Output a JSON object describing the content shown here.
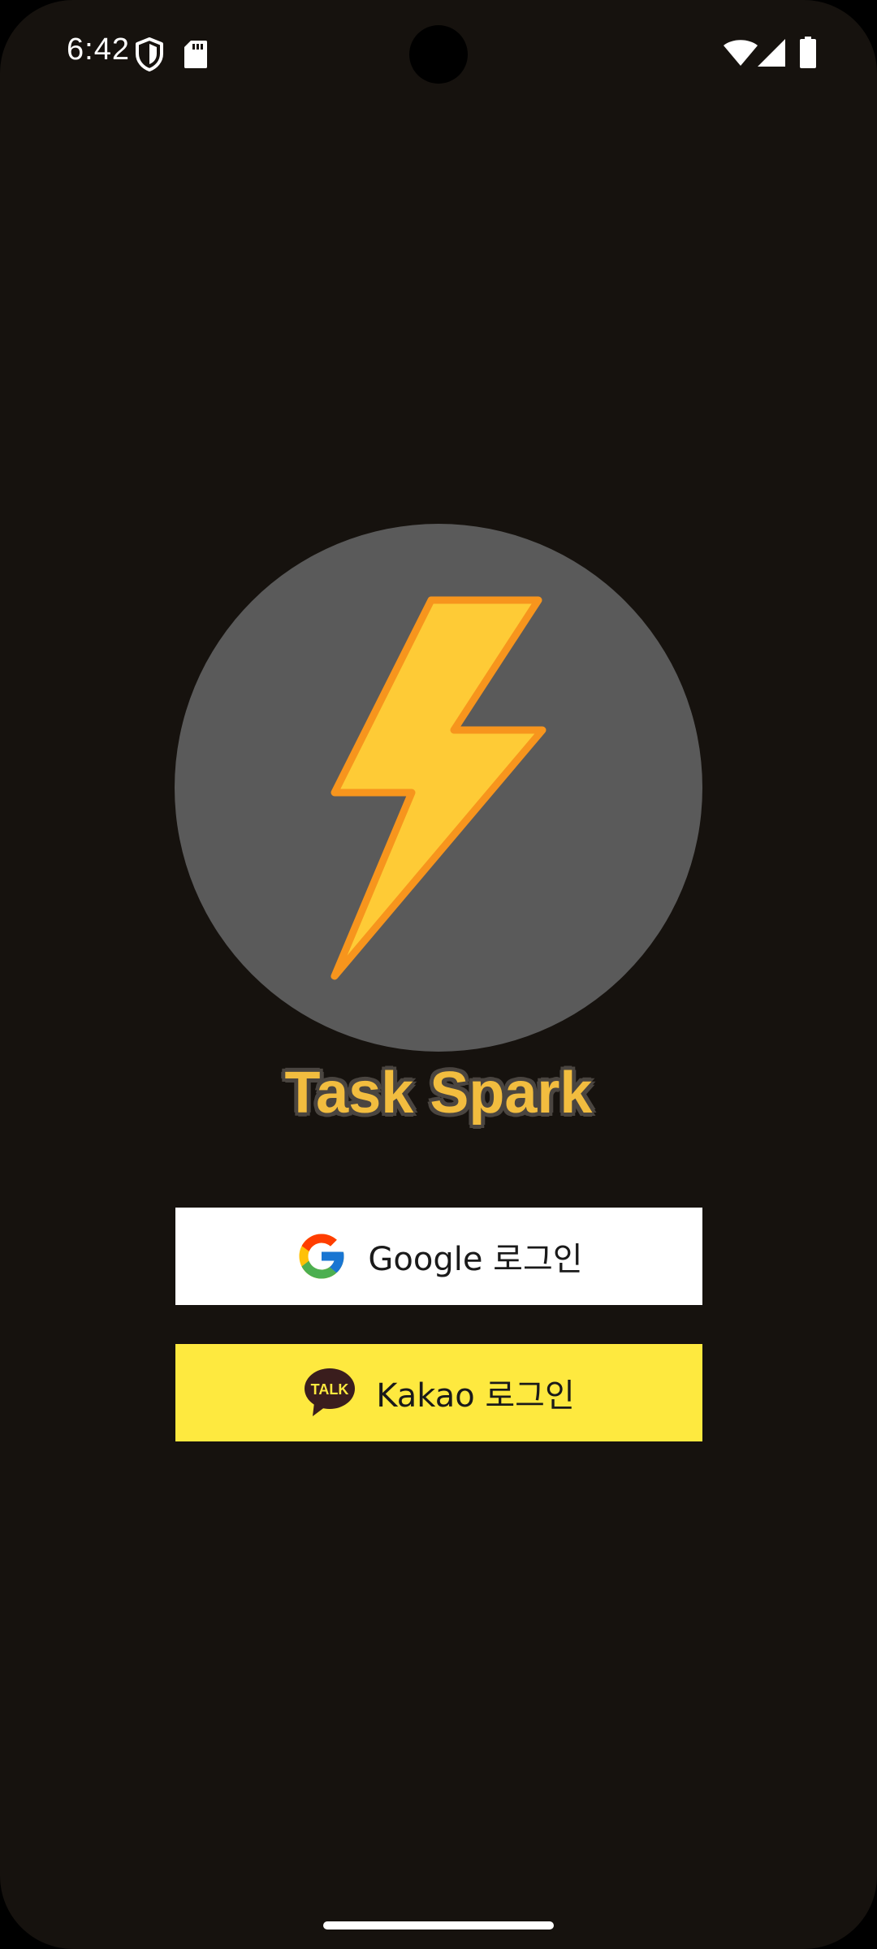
{
  "status_bar": {
    "time": "6:42",
    "icons": [
      "shield-icon",
      "sd-card-icon",
      "wifi-icon",
      "cellular-signal-icon",
      "battery-icon"
    ]
  },
  "logo": {
    "icon": "lightning-bolt-icon",
    "circle_color": "#5a5a5a",
    "bolt_fill": "#fecb36",
    "bolt_stroke": "#f7951d"
  },
  "app": {
    "title": "Task Spark",
    "title_color": "#f2bd3f"
  },
  "buttons": {
    "google": {
      "label": "Google 로그인",
      "icon": "google-g-icon",
      "background": "#ffffff"
    },
    "kakao": {
      "label": "Kakao 로그인",
      "icon": "kakaotalk-bubble-icon",
      "icon_text": "TALK",
      "background": "#fee93f"
    }
  },
  "colors": {
    "background": "#16120e"
  }
}
